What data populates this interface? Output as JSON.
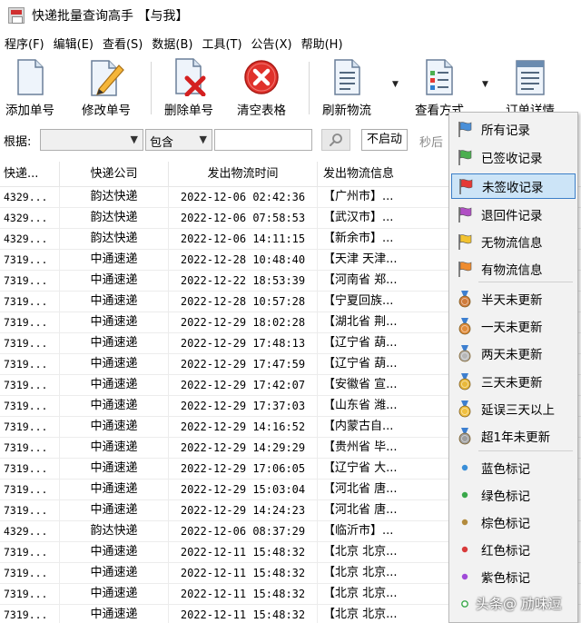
{
  "window": {
    "title": "快递批量查询高手 【与我】"
  },
  "menubar": [
    "程序(F)",
    "编辑(E)",
    "查看(S)",
    "数据(B)",
    "工具(T)",
    "公告(X)",
    "帮助(H)"
  ],
  "toolbar": {
    "add": "添加单号",
    "edit": "修改单号",
    "delete": "删除单号",
    "clear": "清空表格",
    "refresh": "刷新物流",
    "view_mode": "查看方式",
    "details": "订单详情"
  },
  "filter": {
    "label": "根据:",
    "field_value": "",
    "match_value": "包含",
    "keyword_value": "",
    "start_button": "不启动",
    "interval_label": "秒后"
  },
  "table": {
    "columns": [
      "快递...",
      "快递公司",
      "发出物流时间",
      "发出物流信息"
    ],
    "rows": [
      [
        "4329...",
        "韵达快递",
        "2022-12-06 02:42:36",
        "【广州市】..."
      ],
      [
        "4329...",
        "韵达快递",
        "2022-12-06 07:58:53",
        "【武汉市】..."
      ],
      [
        "4329...",
        "韵达快递",
        "2022-12-06 14:11:15",
        "【新余市】..."
      ],
      [
        "7319...",
        "中通速递",
        "2022-12-28 10:48:40",
        "【天津 天津..."
      ],
      [
        "7319...",
        "中通速递",
        "2022-12-22 18:53:39",
        "【河南省 郑..."
      ],
      [
        "7319...",
        "中通速递",
        "2022-12-28 10:57:28",
        "【宁夏回族..."
      ],
      [
        "7319...",
        "中通速递",
        "2022-12-29 18:02:28",
        "【湖北省 荆..."
      ],
      [
        "7319...",
        "中通速递",
        "2022-12-29 17:48:13",
        "【辽宁省 葫..."
      ],
      [
        "7319...",
        "中通速递",
        "2022-12-29 17:47:59",
        "【辽宁省 葫..."
      ],
      [
        "7319...",
        "中通速递",
        "2022-12-29 17:42:07",
        "【安徽省 宣..."
      ],
      [
        "7319...",
        "中通速递",
        "2022-12-29 17:37:03",
        "【山东省 潍..."
      ],
      [
        "7319...",
        "中通速递",
        "2022-12-29 14:16:52",
        "【内蒙古自..."
      ],
      [
        "7319...",
        "中通速递",
        "2022-12-29 14:29:29",
        "【贵州省 毕..."
      ],
      [
        "7319...",
        "中通速递",
        "2022-12-29 17:06:05",
        "【辽宁省 大..."
      ],
      [
        "7319...",
        "中通速递",
        "2022-12-29 15:03:04",
        "【河北省 唐..."
      ],
      [
        "7319...",
        "中通速递",
        "2022-12-29 14:24:23",
        "【河北省 唐..."
      ],
      [
        "4329...",
        "韵达快递",
        "2022-12-06 08:37:29",
        "【临沂市】..."
      ],
      [
        "7319...",
        "中通速递",
        "2022-12-11 15:48:32",
        "【北京 北京..."
      ],
      [
        "7319...",
        "中通速递",
        "2022-12-11 15:48:32",
        "【北京 北京..."
      ],
      [
        "7319...",
        "中通速递",
        "2022-12-11 15:48:32",
        "【北京 北京..."
      ],
      [
        "7319...",
        "中通速递",
        "2022-12-11 15:48:32",
        "【北京 北京..."
      ]
    ]
  },
  "dropdown": {
    "items": [
      {
        "label": "所有记录",
        "icon": "flag-blue-icon",
        "color": "#4a90d9"
      },
      {
        "label": "已签收记录",
        "icon": "flag-green-icon",
        "color": "#4caf50"
      },
      {
        "label": "未签收记录",
        "icon": "flag-red-icon",
        "color": "#e53935"
      },
      {
        "label": "退回件记录",
        "icon": "flag-purple-icon",
        "color": "#b04fc4"
      },
      {
        "label": "无物流信息",
        "icon": "flag-yellow-icon",
        "color": "#f2c230"
      },
      {
        "label": "有物流信息",
        "icon": "flag-orange-icon",
        "color": "#ef8c2f"
      },
      {
        "label": "半天未更新",
        "icon": "medal-bronze-icon",
        "color": "#d07c3c"
      },
      {
        "label": "一天未更新",
        "icon": "medal-orange-icon",
        "color": "#e08c3c"
      },
      {
        "label": "两天未更新",
        "icon": "medal-silver-icon",
        "color": "#b6b6b6"
      },
      {
        "label": "三天未更新",
        "icon": "medal-gold-icon",
        "color": "#e9b93a"
      },
      {
        "label": "延误三天以上",
        "icon": "medal-gold2-icon",
        "color": "#f0c040"
      },
      {
        "label": "超1年未更新",
        "icon": "medal-grey-icon",
        "color": "#9e9e9e"
      },
      {
        "label": "蓝色标记",
        "icon": "dot-blue-icon",
        "color": "#3a8fd8"
      },
      {
        "label": "绿色标记",
        "icon": "dot-green-icon",
        "color": "#3aa84a"
      },
      {
        "label": "棕色标记",
        "icon": "dot-brown-icon",
        "color": "#b38b3d"
      },
      {
        "label": "红色标记",
        "icon": "dot-red-icon",
        "color": "#d83a3a"
      },
      {
        "label": "紫色标记",
        "icon": "dot-purple-icon",
        "color": "#a04ad8"
      },
      {
        "label": "",
        "icon": "dot-hollow-green-icon",
        "color": "#3aa84a"
      }
    ],
    "selected": "未签收记录"
  },
  "watermark": "头条@ 劢味逗"
}
